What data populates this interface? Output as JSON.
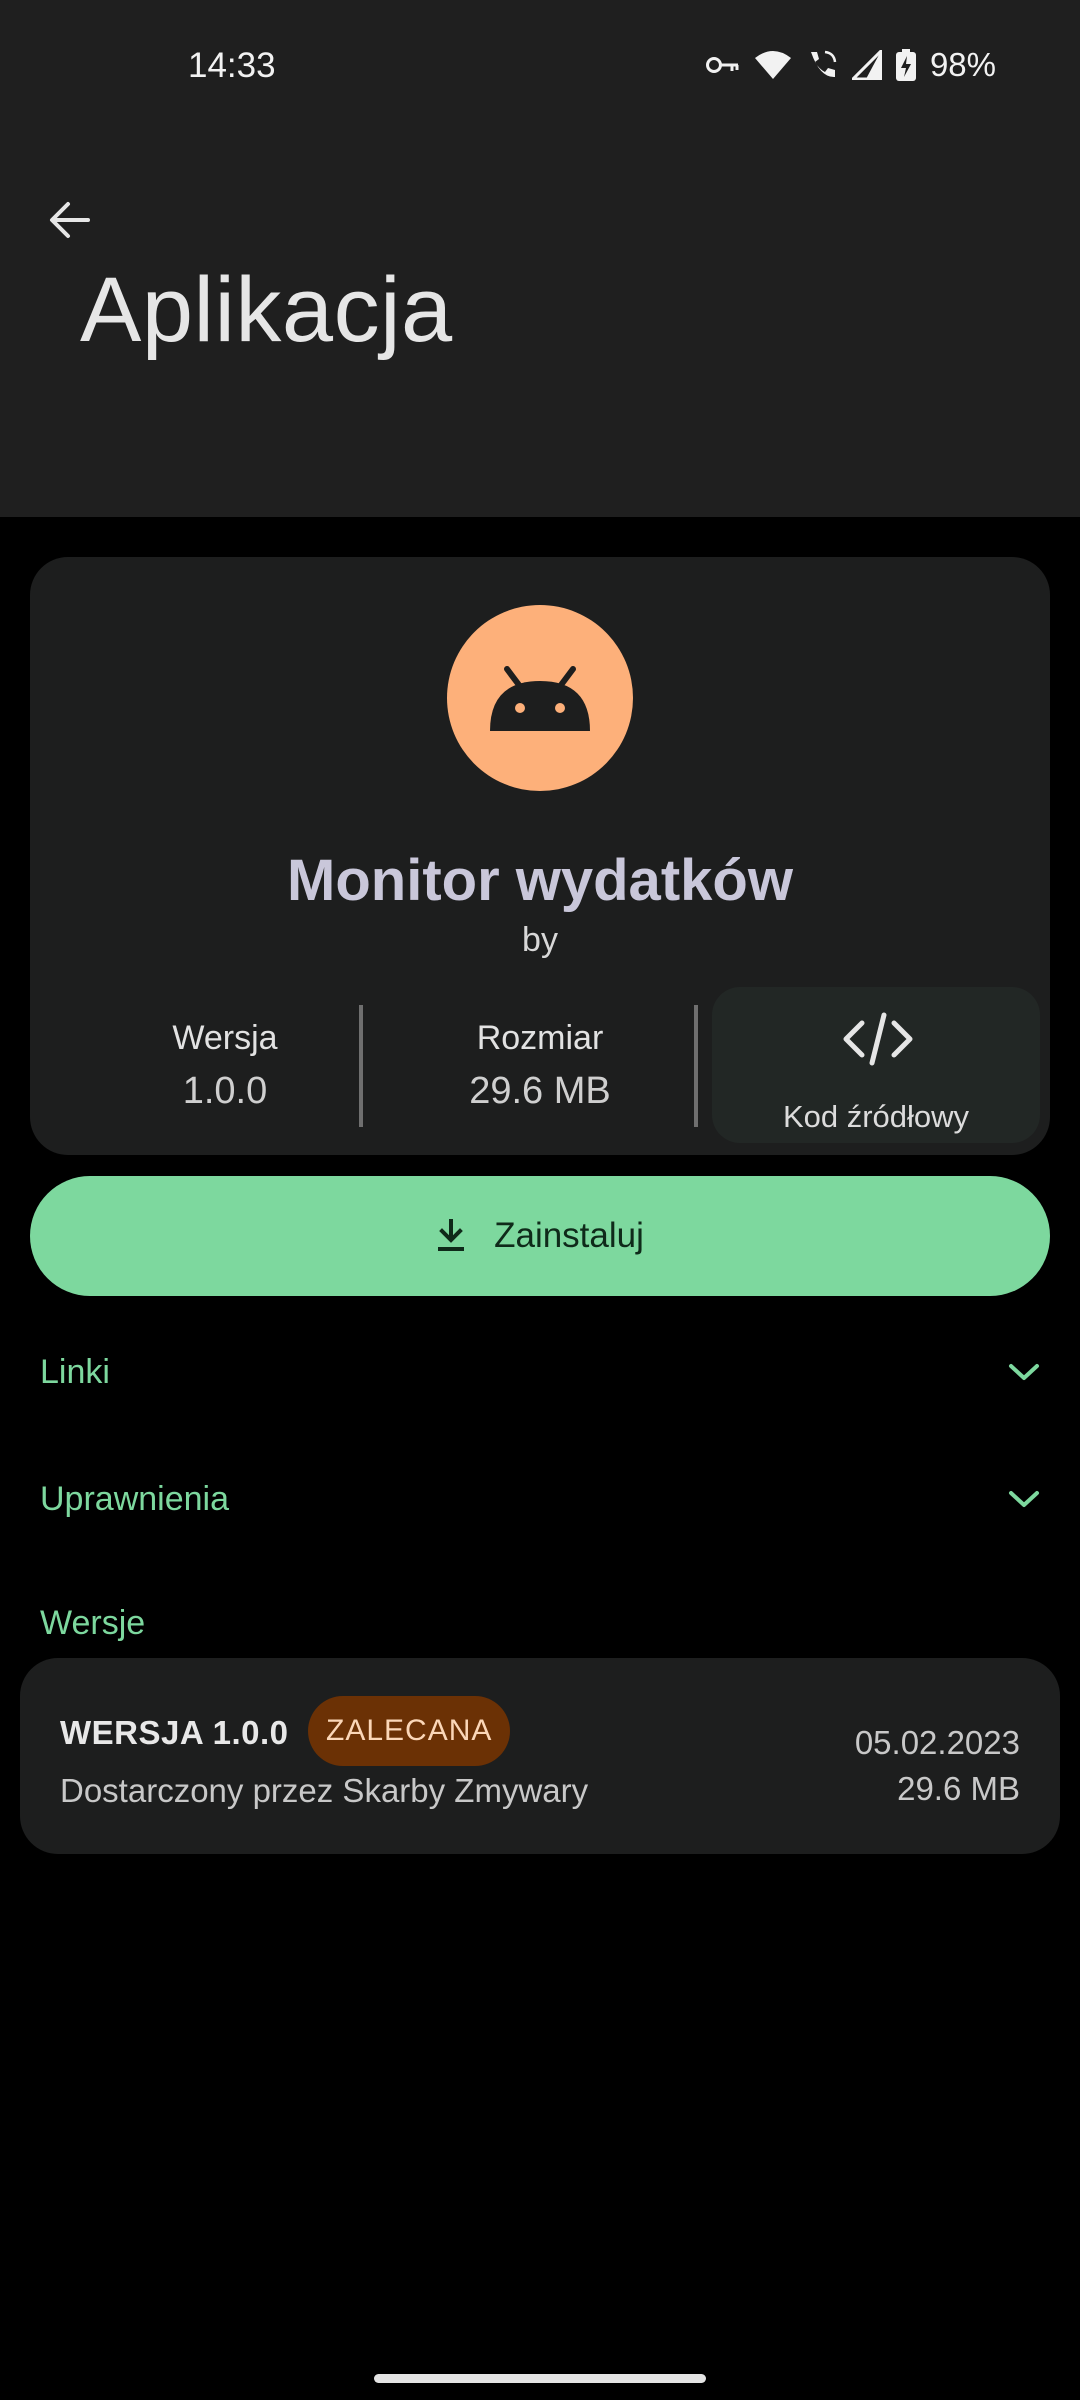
{
  "status_bar": {
    "time": "14:33",
    "battery": "98%",
    "icons": [
      "vpn-key-icon",
      "wifi-icon",
      "wifi-calling-icon",
      "cellular-signal-icon",
      "battery-charging-icon"
    ]
  },
  "header": {
    "title": "Aplikacja",
    "back_icon": "arrow-back-icon"
  },
  "app": {
    "name": "Monitor wydatków",
    "by": "by",
    "icon": "android-icon",
    "icon_bg": "#fdb07a"
  },
  "meta": {
    "version_label": "Wersja",
    "version_value": "1.0.0",
    "size_label": "Rozmiar",
    "size_value": "29.6 MB",
    "source_label": "Kod źródłowy"
  },
  "install_button": {
    "label": "Zainstaluj",
    "icon": "download-icon",
    "color": "#7dd89e"
  },
  "sections": {
    "links": "Linki",
    "permissions": "Uprawnienia",
    "versions": "Wersje"
  },
  "versions": [
    {
      "title": "WERSJA 1.0.0",
      "badge": "ZALECANA",
      "provider": "Dostarczony przez Skarby Zmywary",
      "date": "05.02.2023",
      "size": "29.6 MB"
    }
  ],
  "colors": {
    "accent": "#7dd89e",
    "badge_bg": "#6b3105",
    "surface": "#1d1e1e"
  }
}
